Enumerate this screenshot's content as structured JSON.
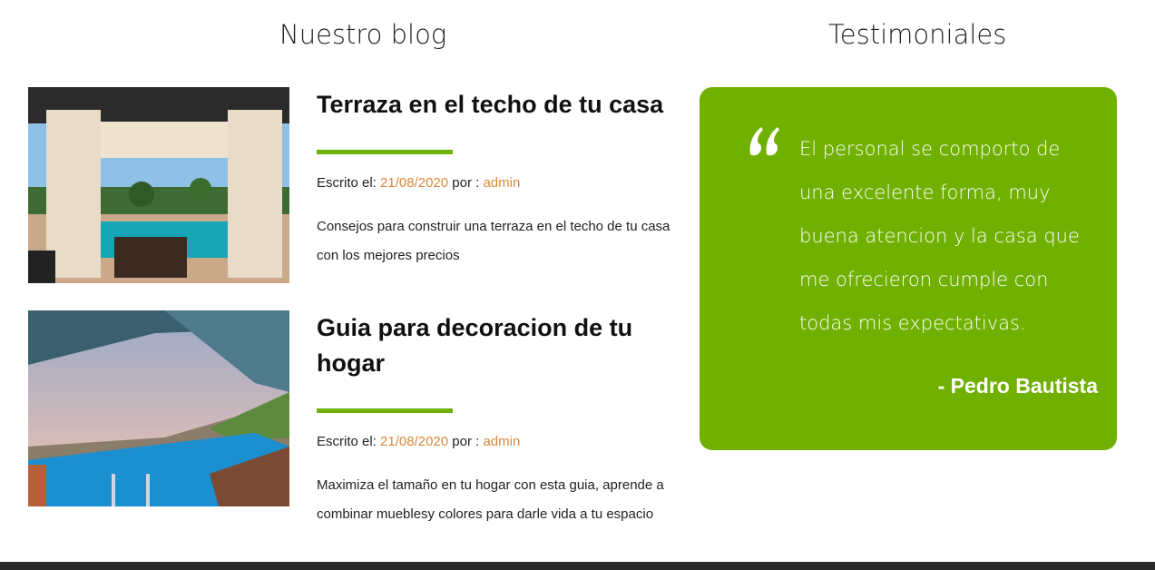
{
  "blog": {
    "title": "Nuestro blog",
    "posts": [
      {
        "title": "Terraza en el techo de tu casa",
        "meta_label": "Escrito el:",
        "date": "21/08/2020",
        "by_label": "por :",
        "author": "admin",
        "excerpt": "Consejos para construir una terraza en el techo de tu casa con los mejores precios"
      },
      {
        "title": "Guia para decoracion de tu hogar",
        "meta_label": "Escrito el:",
        "date": "21/08/2020",
        "by_label": "por :",
        "author": "admin",
        "excerpt": "Maximiza el tamaño en tu hogar con esta guia, aprende a combinar mueblesy colores para darle vida a tu espacio"
      }
    ]
  },
  "testimonials": {
    "title": "Testimoniales",
    "quote": "El personal se comporto de una excelente forma, muy buena atencion y la casa que me ofrecieron cumple con todas mis expectativas.",
    "author": "- Pedro Bautista"
  },
  "colors": {
    "accent_green": "#6fb000",
    "link_orange": "#d98a3a",
    "footer": "#2a2a2a"
  },
  "icons": {
    "quote": "quote-open-icon"
  }
}
